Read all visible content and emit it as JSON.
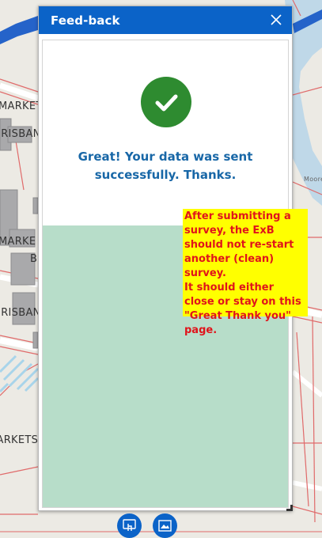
{
  "panel": {
    "title": "Feed-back",
    "success_message": "Great! Your data was sent successfully. Thanks."
  },
  "annotation": {
    "text": "After submitting a survey, the ExB should not re-start another (clean) survey.\nIt should either close or stay on this \"Great Thank you\" page."
  },
  "map": {
    "labels": [
      "MARKET",
      "BRISBAN",
      "MARKE",
      "B",
      "BRISBAN",
      "MARKETS",
      "Moore"
    ]
  },
  "colors": {
    "header": "#0b63c8",
    "success_icon": "#2e8b30",
    "success_text": "#1867a7",
    "empty_area": "#b7ddc9",
    "annotation_bg": "#ffff00",
    "annotation_text": "#e0141b"
  }
}
